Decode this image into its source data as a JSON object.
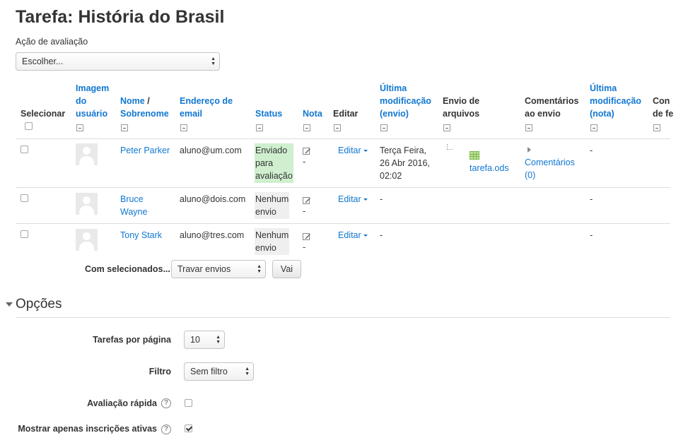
{
  "page": {
    "title": "Tarefa: História do Brasil"
  },
  "grading_action": {
    "label": "Ação de avaliação",
    "selected": "Escolher..."
  },
  "table": {
    "headers": {
      "select": "Selecionar",
      "image": [
        "Imagem",
        "do",
        "usuário"
      ],
      "name": [
        "Nome",
        "/",
        "Sobrenome"
      ],
      "email": [
        "Endereço de",
        "email"
      ],
      "status": "Status",
      "grade": "Nota",
      "edit": "Editar",
      "last_mod_submission": [
        "Última",
        "modificação",
        "(envio)"
      ],
      "file_submissions": [
        "Envio de",
        "arquivos"
      ],
      "submission_comments": [
        "Comentários",
        "ao envio"
      ],
      "last_mod_grade": [
        "Última",
        "modificação",
        "(nota)"
      ],
      "feedback_comments": [
        "Con",
        "de fe"
      ]
    },
    "rows": [
      {
        "first_name": "Peter Parker",
        "email": "aluno@um.com",
        "status": [
          "Enviado",
          "para",
          "avaliação"
        ],
        "grade": "-",
        "edit": "Editar",
        "last_mod": [
          "Terça Feira,",
          "26 Abr 2016,",
          "02:02"
        ],
        "file": "tarefa.ods",
        "comments": [
          "Comentários",
          "(0)"
        ],
        "last_mod_grade": "-"
      },
      {
        "first_name": [
          "Bruce",
          "Wayne"
        ],
        "email": "aluno@dois.com",
        "status": [
          "Nenhum",
          "envio"
        ],
        "grade": "-",
        "edit": "Editar",
        "last_mod": "-",
        "last_mod_grade": "-"
      },
      {
        "first_name": "Tony Stark",
        "email": "aluno@tres.com",
        "status": [
          "Nenhum",
          "envio"
        ],
        "grade": "-",
        "edit": "Editar",
        "last_mod": "-",
        "last_mod_grade": "-"
      }
    ]
  },
  "bulk": {
    "label": "Com selecionados...",
    "selected": "Travar envios",
    "go": "Vai"
  },
  "options": {
    "title": "Opções",
    "per_page_label": "Tarefas por página",
    "per_page_value": "10",
    "filter_label": "Filtro",
    "filter_value": "Sem filtro",
    "quick_grading_label": "Avaliação rápida",
    "quick_grading_checked": false,
    "active_only_label": "Mostrar apenas inscrições ativas",
    "active_only_checked": true
  },
  "colors": {
    "link": "#1177d1",
    "submitted_bg": "#cfefcf",
    "none_bg": "#efefef"
  }
}
